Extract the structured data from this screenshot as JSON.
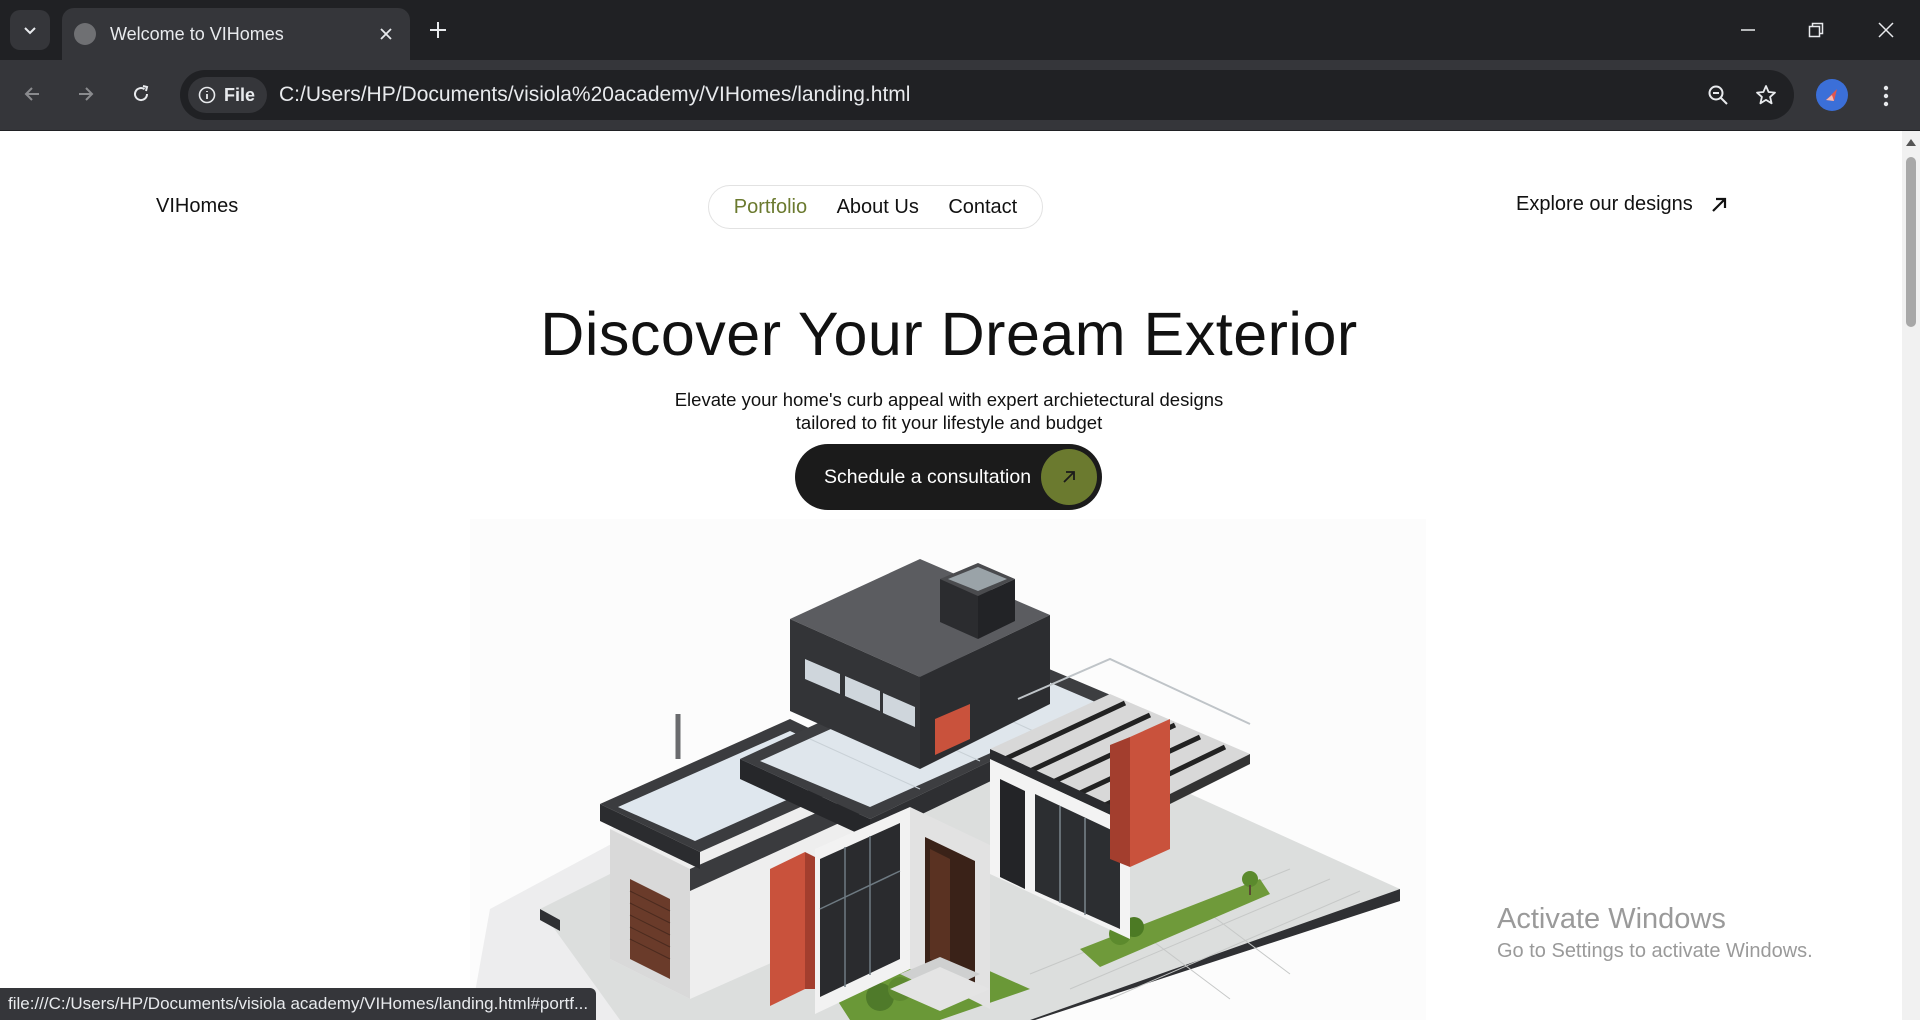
{
  "browser": {
    "tab_title": "Welcome to VIHomes",
    "chip_label": "File",
    "url": "C:/Users/HP/Documents/visiola%20academy/VIHomes/landing.html",
    "status_url": "file:///C:/Users/HP/Documents/visiola academy/VIHomes/landing.html#portf..."
  },
  "site": {
    "brand": "VIHomes",
    "nav": [
      {
        "label": "Portfolio",
        "active": true
      },
      {
        "label": "About Us",
        "active": false
      },
      {
        "label": "Contact",
        "active": false
      }
    ],
    "explore_label": "Explore our designs",
    "hero": {
      "title": "Discover Your Dream Exterior",
      "subtitle_line1": "Elevate your home's curb appeal with expert archietectural designs",
      "subtitle_line2": "tailored to fit your lifestyle and budget",
      "cta_label": "Schedule a consultation"
    }
  },
  "watermark": {
    "line1": "Activate Windows",
    "line2": "Go to Settings to activate Windows."
  },
  "colors": {
    "accent": "#6b7a2f",
    "cta_bg": "#1b1b1b",
    "chrome_dark": "#202124",
    "chrome_toolbar": "#35363a"
  },
  "icons": [
    "tab-search-icon",
    "globe-icon",
    "close-icon",
    "plus-icon",
    "minimize-icon",
    "restore-icon",
    "back-icon",
    "forward-icon",
    "reload-icon",
    "info-icon",
    "zoom-icon",
    "star-icon",
    "profile-icon",
    "kebab-menu-icon",
    "arrow-up-right-icon"
  ]
}
